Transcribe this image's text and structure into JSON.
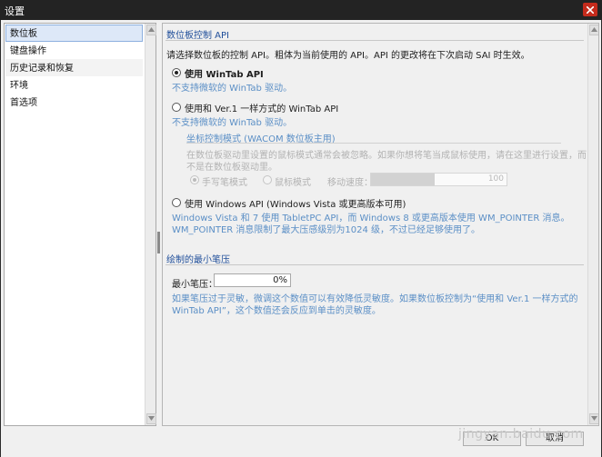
{
  "window": {
    "title": "设置",
    "close_icon": "close-icon"
  },
  "sidebar": {
    "items": [
      {
        "label": "数位板",
        "selected": true
      },
      {
        "label": "键盘操作",
        "selected": false
      },
      {
        "label": "历史记录和恢复",
        "selected": false
      },
      {
        "label": "环境",
        "selected": false
      },
      {
        "label": "首选项",
        "selected": false
      }
    ]
  },
  "tablet_api": {
    "section_title": "数位板控制 API",
    "intro": "请选择数位板的控制 API。粗体为当前使用的 API。API 的更改将在下次启动 SAI 时生效。",
    "wintab": {
      "label": "使用 WinTab API",
      "note": "不支持微软的 WinTab 驱动。",
      "selected": true
    },
    "wintab_v1": {
      "label": "使用和 Ver.1 一样方式的 WinTab API",
      "note": "不支持微软的 WinTab 驱动。",
      "selected": false
    },
    "coord_mode": {
      "title": "坐标控制模式 (WACOM 数位板主用)",
      "desc_line1": "在数位板驱动里设置的鼠标模式通常会被忽略。如果你想将笔当成鼠标使用，请在这里进行设置，而",
      "desc_line2": "不是在数位板驱动里。",
      "pen_mode_label": "手写笔模式",
      "mouse_mode_label": "鼠标模式",
      "speed_label": "移动速度：",
      "speed_value": "100",
      "speed_fraction": 0.47
    },
    "windows_api": {
      "label": "使用 Windows API (Windows Vista 或更高版本可用)",
      "note_line1": "Windows Vista 和 7 使用 TabletPC API，而 Windows 8 或更高版本使用 WM_POINTER 消息。",
      "note_line2": "WM_POINTER 消息限制了最大压感级别为1024 级，不过已经足够使用了。",
      "selected": false
    }
  },
  "min_pressure": {
    "section_title": "绘制的最小笔压",
    "label": "最小笔压：",
    "value": "0%",
    "note_line1": "如果笔压过于灵敏，微调这个数值可以有效降低灵敏度。如果数位板控制为“使用和 Ver.1 一样方式的",
    "note_line2": "WinTab API”，这个数值还会反应到单击的灵敏度。"
  },
  "footer": {
    "ok_label": "OK",
    "cancel_label": "取消",
    "watermark": "jingyan.baidu.com"
  },
  "colors": {
    "accent": "#1f4e9a",
    "note_blue": "#5b8fc6",
    "selected_bg": "#dde8f8",
    "titlebar": "#232323",
    "close": "#c42b1c"
  }
}
